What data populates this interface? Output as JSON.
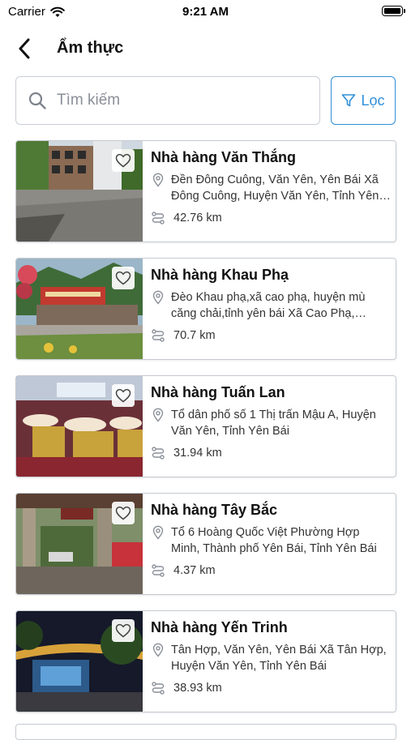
{
  "status_bar": {
    "carrier": "Carrier",
    "time": "9:21 AM"
  },
  "header": {
    "title": "Ẩm thực"
  },
  "search": {
    "placeholder": "Tìm kiếm"
  },
  "filter": {
    "label": "Lọc"
  },
  "restaurants": [
    {
      "name": "Nhà hàng Văn Thắng",
      "address": "Đền Đông Cuông, Văn Yên, Yên Bái  Xã Đông Cuông, Huyện Văn Yên, Tỉnh Yên Bái",
      "distance": "42.76 km"
    },
    {
      "name": "Nhà hàng Khau Phạ",
      "address": "Đèo Khau phạ,xã cao phạ, huyện mù căng chải,tỉnh yên bái  Xã Cao Phạ, Huyện Mù Cang Chải, Tỉnh Yên Bái",
      "distance": "70.7 km"
    },
    {
      "name": "Nhà hàng Tuấn Lan",
      "address": "Tổ dân phố số 1  Thị trấn Mậu A, Huyện Văn Yên, Tỉnh Yên Bái",
      "distance": "31.94 km"
    },
    {
      "name": "Nhà hàng Tây Bắc",
      "address": "Tổ 6 Hoàng Quốc Việt  Phường Hợp Minh, Thành phố Yên Bái, Tỉnh Yên Bái",
      "distance": "4.37 km"
    },
    {
      "name": "Nhà hàng Yến Trinh",
      "address": "Tân Hợp, Văn Yên, Yên Bái  Xã Tân Hợp, Huyện Văn Yên, Tỉnh Yên Bái",
      "distance": "38.93 km"
    }
  ],
  "colors": {
    "accent": "#2f8fd8",
    "border": "#c5cad1",
    "icon_gray": "#8a8f98"
  }
}
